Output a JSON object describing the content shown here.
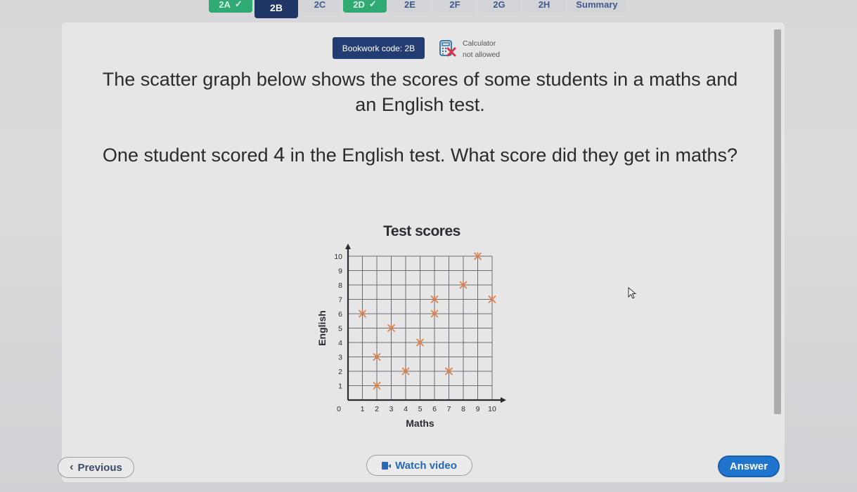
{
  "tabs": [
    {
      "label": "2A",
      "state": "done"
    },
    {
      "label": "2B",
      "state": "active"
    },
    {
      "label": "2C",
      "state": "todo"
    },
    {
      "label": "2D",
      "state": "done"
    },
    {
      "label": "2E",
      "state": "todo"
    },
    {
      "label": "2F",
      "state": "todo"
    },
    {
      "label": "2G",
      "state": "todo"
    },
    {
      "label": "2H",
      "state": "todo"
    },
    {
      "label": "Summary",
      "state": "todo"
    }
  ],
  "header": {
    "bookwork_code": "Bookwork code: 2B",
    "calculator_line1": "Calculator",
    "calculator_line2": "not allowed",
    "calculator_icon": "calculator-crossed-icon"
  },
  "question": {
    "intro": "The scatter graph below shows the scores of some students in a maths and an English test.",
    "prompt_before": "One student scored ",
    "prompt_number": "4",
    "prompt_after": " in the English test. What score did they get in maths?"
  },
  "chart_data": {
    "type": "scatter",
    "title": "Test scores",
    "xlabel": "Maths",
    "ylabel": "English",
    "xlim": [
      0,
      10
    ],
    "ylim": [
      0,
      10
    ],
    "x_ticks": [
      1,
      2,
      3,
      4,
      5,
      6,
      7,
      8,
      9,
      10
    ],
    "y_ticks": [
      1,
      2,
      3,
      4,
      5,
      6,
      7,
      8,
      9,
      10
    ],
    "origin_label": "0",
    "grid": true,
    "marker": "cross",
    "marker_color": "#e0814a",
    "points": [
      {
        "x": 1,
        "y": 6
      },
      {
        "x": 2,
        "y": 3
      },
      {
        "x": 2,
        "y": 1
      },
      {
        "x": 3,
        "y": 5
      },
      {
        "x": 4,
        "y": 2
      },
      {
        "x": 5,
        "y": 4
      },
      {
        "x": 6,
        "y": 7
      },
      {
        "x": 6,
        "y": 6
      },
      {
        "x": 7,
        "y": 2
      },
      {
        "x": 8,
        "y": 8
      },
      {
        "x": 9,
        "y": 10
      },
      {
        "x": 10,
        "y": 7
      }
    ]
  },
  "footer": {
    "previous_label": "Previous",
    "video_label": "Watch video",
    "answer_label": "Answer"
  },
  "colors": {
    "done_tab": "#2eaa72",
    "active_tab": "#1f3565",
    "answer_button": "#1f75cd"
  }
}
